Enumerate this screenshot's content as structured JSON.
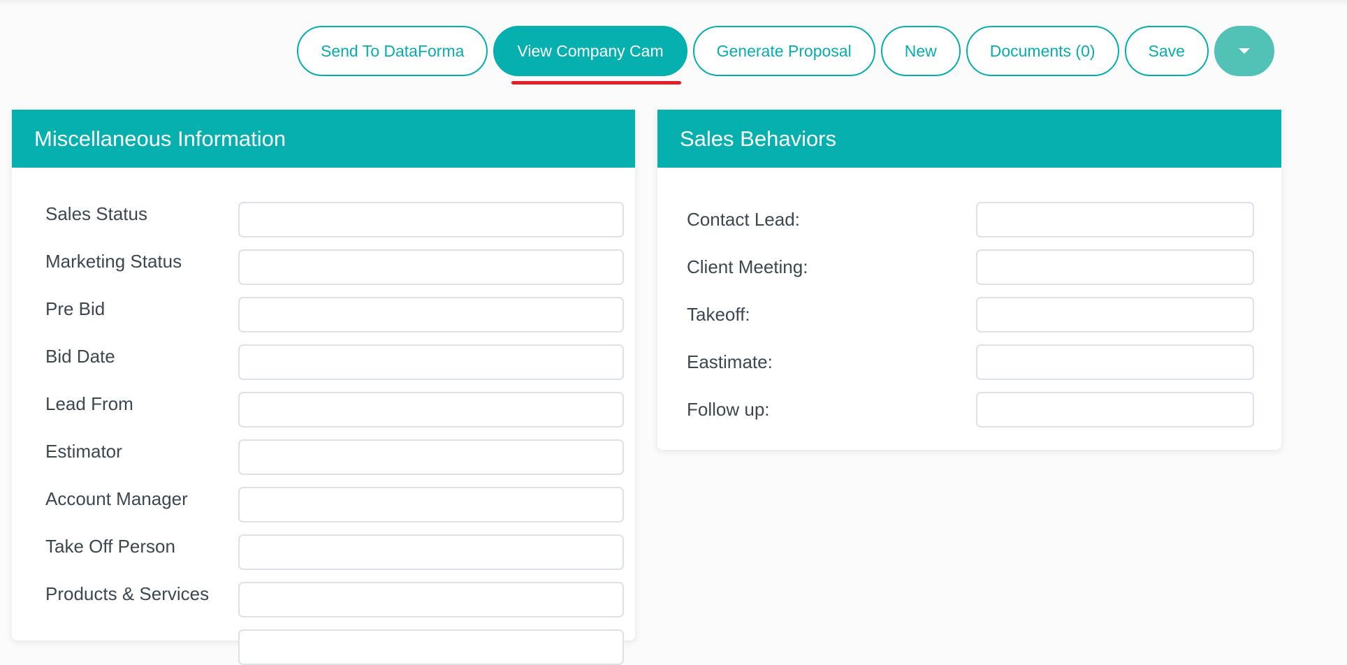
{
  "toolbar": {
    "buttons": [
      {
        "label": "Send To DataForma",
        "style": "outline"
      },
      {
        "label": "View Company Cam",
        "style": "primary",
        "highlighted": true
      },
      {
        "label": "Generate Proposal",
        "style": "outline"
      },
      {
        "label": "New",
        "style": "outline"
      },
      {
        "label": "Documents (0)",
        "style": "outline"
      },
      {
        "label": "Save",
        "style": "outline"
      }
    ],
    "dropdown_icon": "caret-down-icon"
  },
  "misc": {
    "title": "Miscellaneous Information",
    "fields": [
      {
        "label": "Sales Status",
        "value": ""
      },
      {
        "label": "Marketing Status",
        "value": ""
      },
      {
        "label": "Pre Bid",
        "value": ""
      },
      {
        "label": "Bid Date",
        "value": ""
      },
      {
        "label": "Lead From",
        "value": ""
      },
      {
        "label": "Estimator",
        "value": ""
      },
      {
        "label": "Account Manager",
        "value": ""
      },
      {
        "label": "Take Off Person",
        "value": ""
      },
      {
        "label": "Products & Services",
        "value": ""
      }
    ]
  },
  "sales": {
    "title": "Sales Behaviors",
    "fields": [
      {
        "label": "Contact Lead:",
        "value": ""
      },
      {
        "label": "Client Meeting:",
        "value": ""
      },
      {
        "label": "Takeoff:",
        "value": ""
      },
      {
        "label": "Eastimate:",
        "value": ""
      },
      {
        "label": "Follow up:",
        "value": ""
      }
    ]
  },
  "colors": {
    "accent": "#05b0ae",
    "dropdown": "#52c2b6",
    "highlight_underline": "#e31e24"
  }
}
